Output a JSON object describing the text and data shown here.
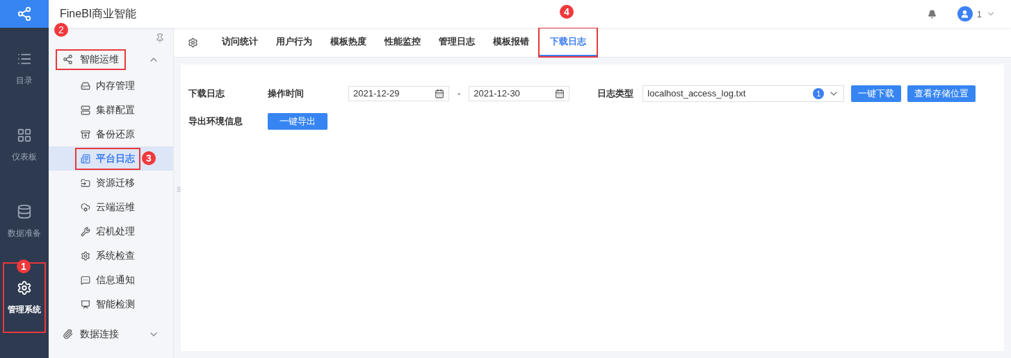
{
  "header": {
    "title": "FineBI商业智能",
    "user": "1"
  },
  "rail": [
    {
      "label": "目录",
      "selected": false,
      "highlighted": false
    },
    {
      "label": "仪表板",
      "selected": false,
      "highlighted": false
    },
    {
      "label": "数据准备",
      "selected": false,
      "highlighted": false
    },
    {
      "label": "管理系统",
      "selected": true,
      "highlighted": true,
      "annotation": "1"
    }
  ],
  "sidebar": {
    "groups": [
      {
        "label": "智能运维",
        "expanded": true,
        "highlighted": true,
        "annotation": "2",
        "children": [
          {
            "label": "内存管理",
            "selected": false,
            "highlighted": false
          },
          {
            "label": "集群配置",
            "selected": false,
            "highlighted": false
          },
          {
            "label": "备份还原",
            "selected": false,
            "highlighted": false
          },
          {
            "label": "平台日志",
            "selected": true,
            "highlighted": true,
            "annotation": "3"
          },
          {
            "label": "资源迁移",
            "selected": false,
            "highlighted": false
          },
          {
            "label": "云端运维",
            "selected": false,
            "highlighted": false
          },
          {
            "label": "宕机处理",
            "selected": false,
            "highlighted": false
          },
          {
            "label": "系统检查",
            "selected": false,
            "highlighted": false
          },
          {
            "label": "信息通知",
            "selected": false,
            "highlighted": false
          },
          {
            "label": "智能检测",
            "selected": false,
            "highlighted": false
          }
        ]
      },
      {
        "label": "数据连接",
        "expanded": false,
        "highlighted": false
      }
    ]
  },
  "tabs": [
    {
      "label": "访问统计",
      "selected": false,
      "highlighted": false
    },
    {
      "label": "用户行为",
      "selected": false,
      "highlighted": false
    },
    {
      "label": "模板热度",
      "selected": false,
      "highlighted": false
    },
    {
      "label": "性能监控",
      "selected": false,
      "highlighted": false
    },
    {
      "label": "管理日志",
      "selected": false,
      "highlighted": false
    },
    {
      "label": "模板报错",
      "selected": false,
      "highlighted": false
    },
    {
      "label": "下载日志",
      "selected": true,
      "highlighted": true,
      "annotation": "4"
    }
  ],
  "form": {
    "section": "下载日志",
    "time_label": "操作时间",
    "start_date": "2021-12-29",
    "date_separator": "-",
    "end_date": "2021-12-30",
    "type_label": "日志类型",
    "log_type": "localhost_access_log.txt",
    "log_type_count": "1",
    "download_button": "一键下载",
    "location_button": "查看存储位置",
    "export_label": "导出环境信息",
    "export_button": "一键导出"
  }
}
